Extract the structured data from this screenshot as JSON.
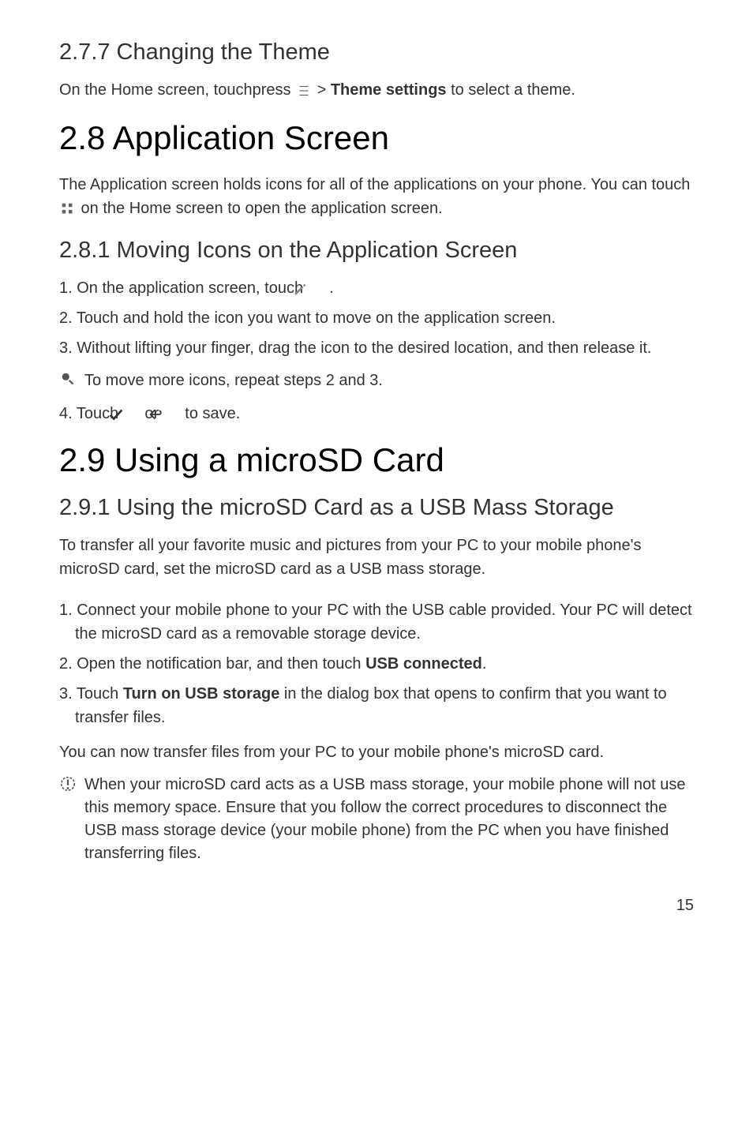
{
  "s277": {
    "title": "2.7.7  Changing the Theme",
    "line1_a": "On the Home screen, touchpress ",
    "line1_b": "  > ",
    "line1_bold": "Theme settings",
    "line1_c": " to select a theme."
  },
  "s28": {
    "title": "2.8  Application Screen",
    "para_a": "The Application screen holds icons for all of the applications on your phone. You can touch ",
    "para_b": " on the Home screen to open the application screen."
  },
  "s281": {
    "title": "2.8.1  Moving Icons on the Application Screen",
    "step1_a": "1. On the application screen, touch ",
    "step1_b": " .",
    "step2": "2. Touch and hold the icon you want to move on the application screen.",
    "step3": "3. Without lifting your finger, drag the icon to the desired location, and then release it.",
    "tip": "To move more icons, repeat steps 2 and 3.",
    "step4_a": "4. Touch ",
    "step4_b": " or ",
    "step4_c": " to save."
  },
  "s29": {
    "title": "2.9  Using a microSD Card"
  },
  "s291": {
    "title": "2.9.1  Using the microSD Card as a USB Mass Storage",
    "intro": "To transfer all your favorite music and pictures from your PC to your mobile phone's microSD card, set the microSD card as a USB mass storage.",
    "step1": "1. Connect your mobile phone to your PC with the USB cable provided. Your PC will detect the microSD card as a removable storage device.",
    "step2_a": "2. Open the notification bar, and then touch ",
    "step2_bold": "USB connected",
    "step2_b": ".",
    "step3_a": "3. Touch ",
    "step3_bold": "Turn on USB storage",
    "step3_b": " in the dialog box that opens to confirm that you want to transfer files.",
    "outro": "You can now transfer files from your PC to your mobile phone's microSD card.",
    "caution": "When your microSD card acts as a USB mass storage, your mobile phone will not use this memory space. Ensure that you follow the correct procedures to disconnect the USB mass storage device (your mobile phone) from the PC when you have finished transferring files."
  },
  "page_number": "15"
}
